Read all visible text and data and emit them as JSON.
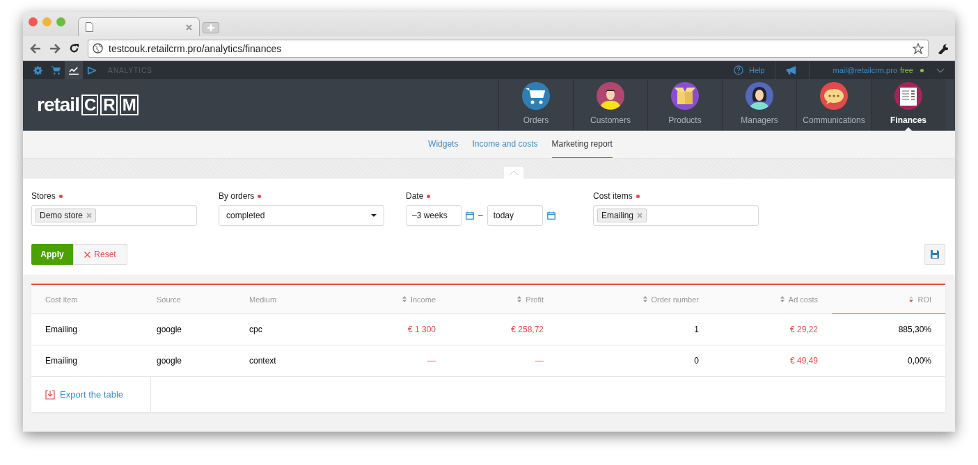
{
  "browser": {
    "url": "testcouk.retailcrm.pro/analytics/finances"
  },
  "topbar": {
    "icons": [
      {
        "kind": "gear",
        "selected": false
      },
      {
        "kind": "cart",
        "selected": false
      },
      {
        "kind": "chart",
        "selected": true
      },
      {
        "kind": "play",
        "selected": false
      }
    ],
    "section": "ANALYTICS",
    "help": "Help",
    "email": "mail@retailcrm.pro",
    "plan": "free"
  },
  "logo": {
    "word": "retail",
    "letters": [
      "C",
      "R",
      "M"
    ]
  },
  "nav": [
    {
      "kind": "orders",
      "label": "Orders",
      "selected": false
    },
    {
      "kind": "customers",
      "label": "Customers",
      "selected": false
    },
    {
      "kind": "products",
      "label": "Products",
      "selected": false
    },
    {
      "kind": "managers",
      "label": "Managers",
      "selected": false
    },
    {
      "kind": "communications",
      "label": "Communications",
      "selected": false
    },
    {
      "kind": "finances",
      "label": "Finances",
      "selected": true
    }
  ],
  "subtabs": [
    {
      "label": "Widgets",
      "selected": false
    },
    {
      "label": "Income and costs",
      "selected": false
    },
    {
      "label": "Marketing report",
      "selected": true
    }
  ],
  "filters": {
    "stores": {
      "label": "Stores",
      "tags": [
        "Demo store"
      ]
    },
    "by_orders": {
      "label": "By orders",
      "value": "completed"
    },
    "date": {
      "label": "Date",
      "from": "–3 weeks",
      "separator": "–",
      "to": "today"
    },
    "cost_items": {
      "label": "Cost items",
      "tags": [
        "Emailing"
      ]
    }
  },
  "buttons": {
    "apply": "Apply",
    "reset": "Reset"
  },
  "table": {
    "columns": [
      {
        "label": "Cost item",
        "kind": "text",
        "sortable": false,
        "sorted": false
      },
      {
        "label": "Source",
        "kind": "text",
        "sortable": false,
        "sorted": false
      },
      {
        "label": "Medium",
        "kind": "text",
        "sortable": false,
        "sorted": false
      },
      {
        "label": "Income",
        "kind": "money",
        "sortable": true,
        "sorted": false
      },
      {
        "label": "Profit",
        "kind": "money",
        "sortable": true,
        "sorted": false
      },
      {
        "label": "Order number",
        "kind": "number",
        "sortable": true,
        "sorted": false
      },
      {
        "label": "Ad costs",
        "kind": "money",
        "sortable": true,
        "sorted": false
      },
      {
        "label": "ROI",
        "kind": "number",
        "sortable": true,
        "sorted": true
      }
    ],
    "rows": [
      [
        "Emailing",
        "google",
        "cpc",
        "€ 1 300",
        "€ 258,72",
        "1",
        "€ 29,22",
        "885,30%"
      ],
      [
        "Emailing",
        "google",
        "context",
        "—",
        "—",
        "0",
        "€ 49,49",
        "0,00%"
      ]
    ]
  },
  "export": "Export the table"
}
